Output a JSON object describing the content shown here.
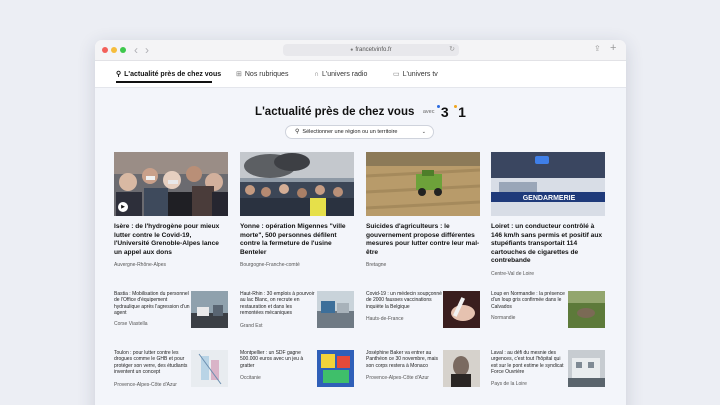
{
  "browser": {
    "url": "francetvinfo.fr",
    "lock_icon": "lock-icon",
    "back_label": "‹",
    "forward_label": "›",
    "reload_label": "↻",
    "share_label": "⇪",
    "new_tab_label": "+"
  },
  "nav": {
    "items": [
      {
        "label": "L'actualité près de chez vous",
        "icon": "location-pin-icon",
        "glyph": "⚲"
      },
      {
        "label": "Nos rubriques",
        "icon": "grid-icon",
        "glyph": "⊞"
      },
      {
        "label": "L'univers radio",
        "icon": "headphones-icon",
        "glyph": "∩"
      },
      {
        "label": "L'univers tv",
        "icon": "tv-icon",
        "glyph": "▭"
      }
    ]
  },
  "heading": {
    "title": "L'actualité près de chez vous",
    "avec": "avec",
    "logo_3": "3",
    "logo_1": "1"
  },
  "region_select": {
    "label": "Sélectionner une région ou un territoire",
    "pin": "⚲",
    "chevron": "⌄"
  },
  "top_stories": [
    {
      "title": "Isère : de l'hydrogène pour mieux lutter contre le Covid-19, l'Université Grenoble-Alpes lance un appel aux dons",
      "region": "Auvergne-Rhône-Alpes",
      "play": "▶"
    },
    {
      "title": "Yonne : opération Migennes \"ville morte\", 500 personnes défilent contre la fermeture de l'usine Benteler",
      "region": "Bourgogne-Franche-comté"
    },
    {
      "title": "Suicides d'agriculteurs : le gouvernement propose différentes mesures pour lutter contre leur mal-être",
      "region": "Bretagne"
    },
    {
      "title": "Loiret : un conducteur contrôlé à 146 km/h sans permis et positif aux stupéfiants transportait 114 cartouches de cigarettes de contrebande",
      "region": "Centre-Val de Loire",
      "photo_text": "GENDARMERIE"
    }
  ],
  "more_stories": [
    {
      "title": "Bastia : Mobilisation du personnel de l'Office d'équipement hydraulique après l'agression d'un agent",
      "region": "Corse Viastella"
    },
    {
      "title": "Haut-Rhin : 30 emplois à pourvoir au lac Blanc, on recrute en restauration et dans les remontées mécaniques",
      "region": "Grand Est"
    },
    {
      "title": "Covid-19 : un médecin soupçonné de 2000 fausses vaccinations inquiète la Belgique",
      "region": "Hauts-de-France"
    },
    {
      "title": "Loup en Normandie : la présence d'un loup gris confirmée dans le Calvados",
      "region": "Normandie"
    },
    {
      "title": "Toulon : pour lutter contre les drogues comme le GHB et pour protéger son verre, des étudiants inventent un concept",
      "region": "Provence-Alpes-Côte d'Azur"
    },
    {
      "title": "Montpellier : un SDF gagne 500.000 euros avec un jeu à gratter",
      "region": "Occitanie"
    },
    {
      "title": "Joséphine Baker va entrer au Panthéon ce 30 novembre, mais son corps restera à Monaco",
      "region": "Provence-Alpes-Côte d'Azur"
    },
    {
      "title": "Laval : au défi du mesnie des urgences, c'est tout l'hôpital qui est sur le pont estime le syndicat Force Ouvrière",
      "region": "Pays de la Loire"
    }
  ],
  "colors": {
    "accent_blue": "#2b6be0",
    "accent_yellow": "#f0a51e",
    "text": "#111111"
  }
}
